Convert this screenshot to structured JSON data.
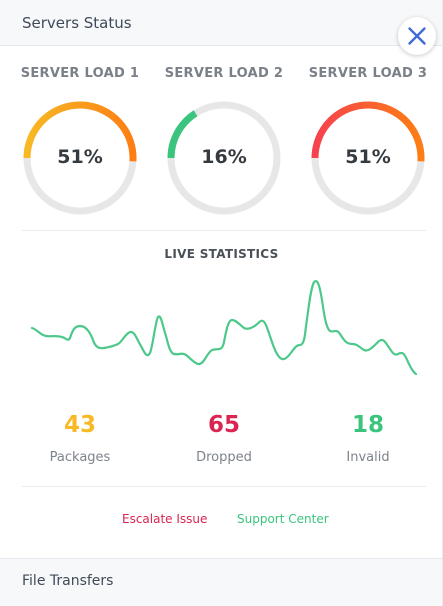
{
  "header": {
    "title": "Servers Status"
  },
  "close_button": {
    "icon": "close-icon"
  },
  "gauges": [
    {
      "title": "SERVER LOAD 1",
      "value_label": "51%",
      "value": 51,
      "color_start": "#f7b924",
      "color_end": "#fd7e14"
    },
    {
      "title": "SERVER LOAD 2",
      "value_label": "16%",
      "value": 16,
      "color_start": "#3ac47d",
      "color_end": "#3ac47d"
    },
    {
      "title": "SERVER LOAD 3",
      "value_label": "51%",
      "value": 51,
      "color_start": "#f7414e",
      "color_end": "#fd7e14"
    }
  ],
  "live": {
    "title": "LIVE STATISTICS",
    "line_color": "#4cc98a"
  },
  "stats": [
    {
      "value": "43",
      "label": "Packages",
      "color": "#f7b924"
    },
    {
      "value": "65",
      "label": "Dropped",
      "color": "#d92550"
    },
    {
      "value": "18",
      "label": "Invalid",
      "color": "#3ac47d"
    }
  ],
  "links": {
    "escalate": "Escalate Issue",
    "escalate_color": "#d92550",
    "support": "Support Center",
    "support_color": "#3ac47d"
  },
  "footer": {
    "title": "File Transfers"
  }
}
